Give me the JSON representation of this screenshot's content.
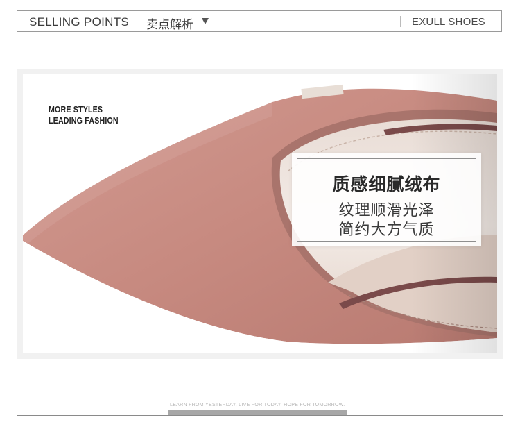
{
  "header": {
    "title_en": "SELLING POINTS",
    "title_cn": "卖点解析",
    "caret_icon": "triangle-down-icon",
    "brand": "EXULL SHOES"
  },
  "product": {
    "slogan_line1": "MORE STYLES",
    "slogan_line2": "LEADING FASHION",
    "feature_title": "质感细腻绒布",
    "feature_line1": "纹理顺滑光泽",
    "feature_line2": "简约大方气质",
    "shoe_color": "#c98c82"
  },
  "footer": {
    "tagline": "LEARN FROM YESTERDAY, LIVE FOR TODAY, HOPE FOR TOMORROW."
  }
}
